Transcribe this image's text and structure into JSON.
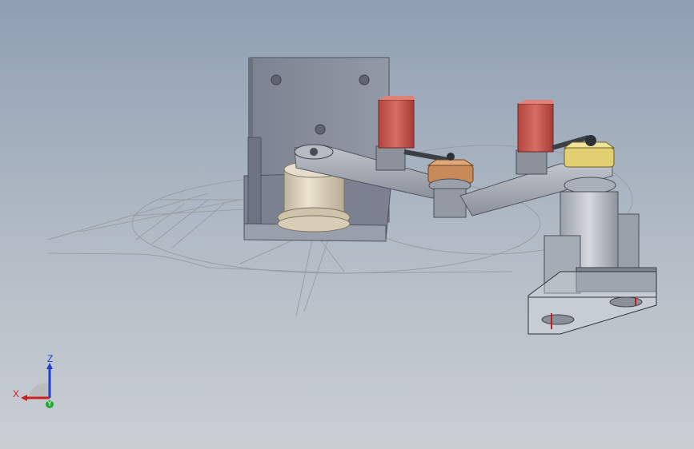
{
  "viewport": {
    "background_top": "#8f9fb2",
    "background_bottom": "#c9ced3"
  },
  "model": {
    "description_hidden": "",
    "motor_color": "#c95a50",
    "pulley_color": "#c88a58",
    "idler_color": "#e2cf72",
    "base_cylinder_color": "#d9cdb5",
    "plate_color": "#858b9a",
    "arm_color": "#a8adb7"
  },
  "triad": {
    "x_label": "X",
    "y_label": "Y",
    "z_label": "Z",
    "x_color": "#cc1f1f",
    "y_color": "#22a83a",
    "z_color": "#1f3fcc"
  }
}
